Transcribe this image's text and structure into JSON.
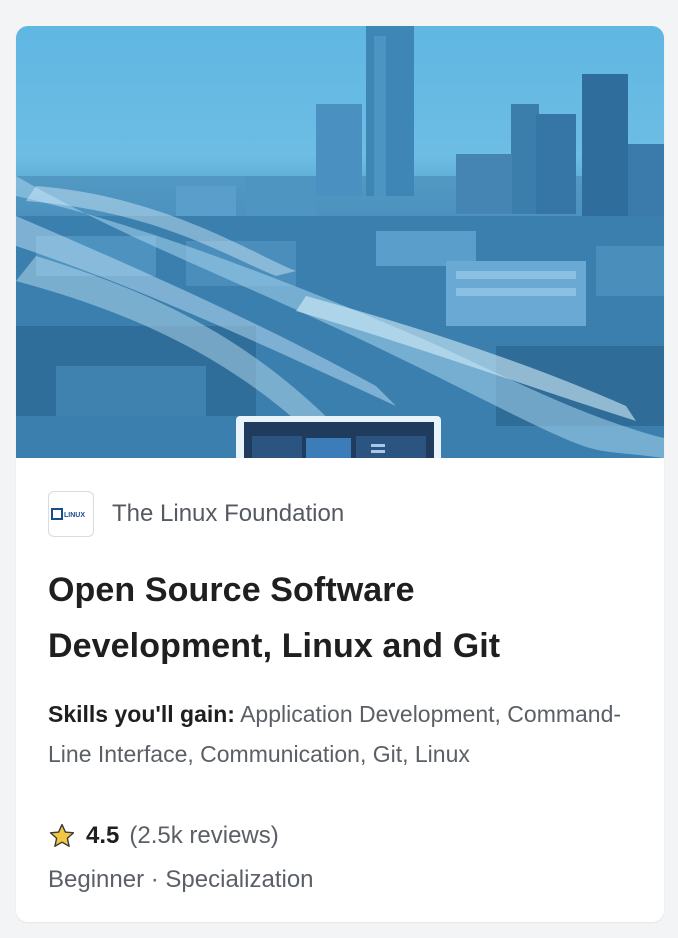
{
  "card": {
    "partner": {
      "logo_text": "LINUX",
      "name": "The Linux Foundation"
    },
    "title_line1": "Open Source Software",
    "title_line2": "Development, Linux and Git",
    "skills_label": "Skills you'll gain:",
    "skills": "Application Development, Command-Line Interface, Communication, Git, Linux",
    "rating": "4.5",
    "reviews": "(2.5k reviews)",
    "level": "Beginner",
    "separator": "·",
    "type": "Specialization"
  },
  "icons": {
    "rating": "star-icon",
    "partner": "linux-foundation-logo"
  },
  "colors": {
    "hero_tint": "#4a9fd0",
    "star": "#f2c744",
    "title": "#1f1f1f",
    "muted": "#5b6066"
  }
}
